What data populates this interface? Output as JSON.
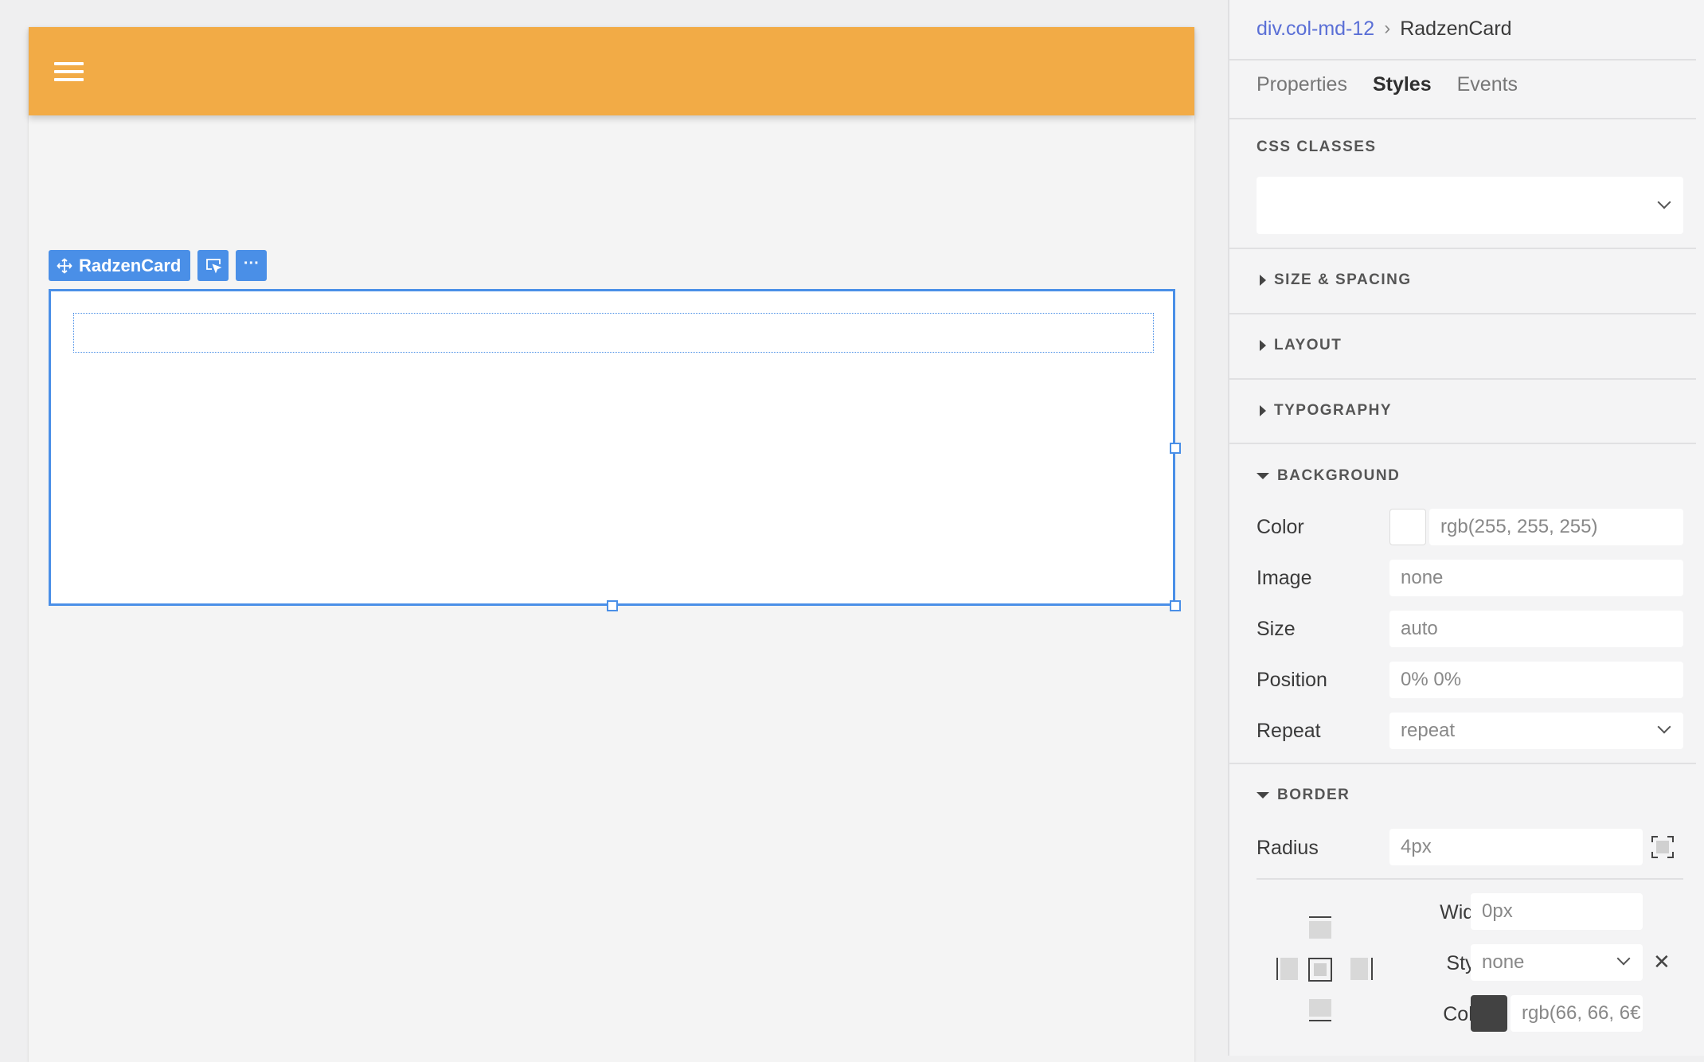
{
  "canvas": {
    "header_color": "#f2ab46",
    "menu_icon": "hamburger-icon",
    "selection": {
      "component_name": "RadzenCard",
      "move_icon": "move-icon",
      "select_parent_icon": "select-parent-icon",
      "more_icon": "more-icon",
      "more_label": "···"
    }
  },
  "panel": {
    "breadcrumb": {
      "parent": "div.col-md-12",
      "separator": "›",
      "current": "RadzenCard"
    },
    "tabs": [
      {
        "label": "Properties",
        "active": false
      },
      {
        "label": "Styles",
        "active": true
      },
      {
        "label": "Events",
        "active": false
      }
    ],
    "css_classes": {
      "title": "CSS CLASSES",
      "value": ""
    },
    "sections": {
      "size_spacing": "SIZE & SPACING",
      "layout": "LAYOUT",
      "typography": "TYPOGRAPHY",
      "background": "BACKGROUND",
      "border": "BORDER"
    },
    "background": {
      "color_label": "Color",
      "color_value": "rgb(255, 255, 255)",
      "color_swatch": "#ffffff",
      "image_label": "Image",
      "image_value": "none",
      "size_label": "Size",
      "size_value": "auto",
      "position_label": "Position",
      "position_value": "0% 0%",
      "repeat_label": "Repeat",
      "repeat_value": "repeat"
    },
    "border": {
      "radius_label": "Radius",
      "radius_value": "4px",
      "width_label": "Width",
      "width_value": "0px",
      "style_label": "Style",
      "style_value": "none",
      "color_label": "Color",
      "color_value": "rgb(66, 66, 6€",
      "color_swatch": "#424242",
      "clear_label": "✕"
    }
  }
}
